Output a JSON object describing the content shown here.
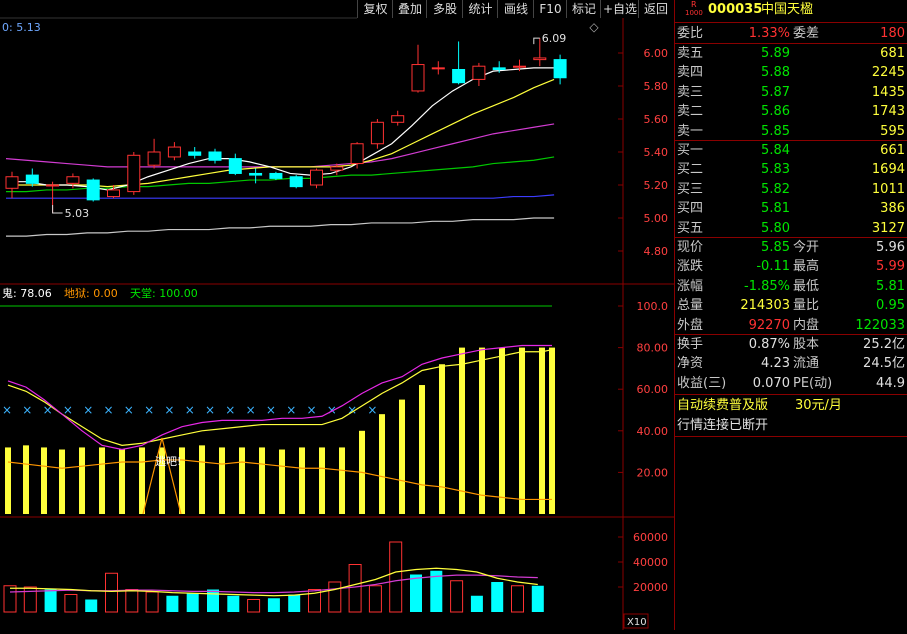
{
  "toolbar": {
    "items": [
      "复权",
      "叠加",
      "多股",
      "统计",
      "画线",
      "F10",
      "标记",
      "+自选",
      "返回"
    ],
    "diamond": "◇"
  },
  "main_chart": {
    "title_value": "0: 5.13",
    "y_ticks": [
      "6.00",
      "5.80",
      "5.60",
      "5.40",
      "5.20",
      "5.00",
      "4.80"
    ],
    "y_tick_values": [
      6.0,
      5.8,
      5.6,
      5.4,
      5.2,
      5.0,
      4.8
    ],
    "high_label": "6.09",
    "low_label": "5.03",
    "candles": [
      {
        "o": 5.18,
        "c": 5.25,
        "h": 5.28,
        "l": 5.12
      },
      {
        "o": 5.26,
        "c": 5.21,
        "h": 5.3,
        "l": 5.19
      },
      {
        "o": 5.2,
        "c": 5.2,
        "h": 5.22,
        "l": 5.03
      },
      {
        "o": 5.21,
        "c": 5.25,
        "h": 5.27,
        "l": 5.18
      },
      {
        "o": 5.23,
        "c": 5.11,
        "h": 5.24,
        "l": 5.1
      },
      {
        "o": 5.13,
        "c": 5.17,
        "h": 5.2,
        "l": 5.12
      },
      {
        "o": 5.16,
        "c": 5.38,
        "h": 5.4,
        "l": 5.14
      },
      {
        "o": 5.32,
        "c": 5.4,
        "h": 5.48,
        "l": 5.3
      },
      {
        "o": 5.37,
        "c": 5.43,
        "h": 5.46,
        "l": 5.35
      },
      {
        "o": 5.4,
        "c": 5.38,
        "h": 5.43,
        "l": 5.36
      },
      {
        "o": 5.4,
        "c": 5.35,
        "h": 5.42,
        "l": 5.33
      },
      {
        "o": 5.36,
        "c": 5.27,
        "h": 5.39,
        "l": 5.26
      },
      {
        "o": 5.27,
        "c": 5.26,
        "h": 5.3,
        "l": 5.21
      },
      {
        "o": 5.27,
        "c": 5.24,
        "h": 5.28,
        "l": 5.23
      },
      {
        "o": 5.25,
        "c": 5.19,
        "h": 5.26,
        "l": 5.18
      },
      {
        "o": 5.2,
        "c": 5.29,
        "h": 5.3,
        "l": 5.18
      },
      {
        "o": 5.29,
        "c": 5.31,
        "h": 5.33,
        "l": 5.26
      },
      {
        "o": 5.33,
        "c": 5.45,
        "h": 5.46,
        "l": 5.3
      },
      {
        "o": 5.45,
        "c": 5.58,
        "h": 5.6,
        "l": 5.42
      },
      {
        "o": 5.58,
        "c": 5.62,
        "h": 5.65,
        "l": 5.56
      },
      {
        "o": 5.77,
        "c": 5.93,
        "h": 6.05,
        "l": 5.76
      },
      {
        "o": 5.91,
        "c": 5.91,
        "h": 5.95,
        "l": 5.87
      },
      {
        "o": 5.9,
        "c": 5.82,
        "h": 6.07,
        "l": 5.81
      },
      {
        "o": 5.84,
        "c": 5.92,
        "h": 5.94,
        "l": 5.8
      },
      {
        "o": 5.91,
        "c": 5.9,
        "h": 5.95,
        "l": 5.88
      },
      {
        "o": 5.92,
        "c": 5.92,
        "h": 5.96,
        "l": 5.89
      },
      {
        "o": 5.96,
        "c": 5.97,
        "h": 6.09,
        "l": 5.92
      },
      {
        "o": 5.96,
        "c": 5.85,
        "h": 5.99,
        "l": 5.81
      }
    ],
    "ma_white": [
      5.22,
      5.22,
      5.2,
      5.2,
      5.19,
      5.17,
      5.2,
      5.25,
      5.29,
      5.33,
      5.36,
      5.36,
      5.34,
      5.31,
      5.27,
      5.26,
      5.27,
      5.31,
      5.38,
      5.45,
      5.56,
      5.68,
      5.77,
      5.84,
      5.89,
      5.9,
      5.91,
      5.91
    ],
    "ma_yellow": [
      5.2,
      5.2,
      5.2,
      5.2,
      5.2,
      5.19,
      5.2,
      5.21,
      5.23,
      5.25,
      5.27,
      5.29,
      5.3,
      5.31,
      5.31,
      5.31,
      5.31,
      5.32,
      5.35,
      5.39,
      5.45,
      5.51,
      5.57,
      5.63,
      5.68,
      5.73,
      5.79,
      5.84
    ],
    "ma_magenta": [
      5.36,
      5.35,
      5.34,
      5.33,
      5.32,
      5.31,
      5.31,
      5.31,
      5.31,
      5.31,
      5.31,
      5.31,
      5.31,
      5.31,
      5.31,
      5.31,
      5.32,
      5.33,
      5.34,
      5.36,
      5.39,
      5.42,
      5.45,
      5.48,
      5.51,
      5.53,
      5.55,
      5.57
    ],
    "ma_green": [
      5.16,
      5.16,
      5.17,
      5.17,
      5.18,
      5.18,
      5.19,
      5.19,
      5.2,
      5.21,
      5.21,
      5.22,
      5.23,
      5.23,
      5.24,
      5.24,
      5.25,
      5.26,
      5.26,
      5.27,
      5.28,
      5.29,
      5.3,
      5.31,
      5.33,
      5.34,
      5.35,
      5.37
    ],
    "ma_blue": [
      5.12,
      5.12,
      5.12,
      5.12,
      5.12,
      5.12,
      5.12,
      5.12,
      5.12,
      5.12,
      5.12,
      5.12,
      5.12,
      5.12,
      5.12,
      5.12,
      5.12,
      5.12,
      5.12,
      5.12,
      5.12,
      5.12,
      5.12,
      5.12,
      5.12,
      5.13,
      5.13,
      5.14
    ],
    "ma_grey": [
      4.89,
      4.89,
      4.9,
      4.9,
      4.91,
      4.91,
      4.92,
      4.92,
      4.93,
      4.93,
      4.93,
      4.94,
      4.94,
      4.95,
      4.95,
      4.95,
      4.96,
      4.96,
      4.97,
      4.97,
      4.97,
      4.98,
      4.98,
      4.99,
      4.99,
      4.99,
      5.0,
      5.0
    ]
  },
  "indicator": {
    "legend": [
      {
        "label": "鬼",
        "value": "78.06",
        "color": "#ffffff"
      },
      {
        "label": "地狱",
        "value": "0.00",
        "color": "#ff9600"
      },
      {
        "label": "天堂",
        "value": "100.00",
        "color": "#00e600"
      }
    ],
    "y_ticks": [
      "100.0",
      "80.00",
      "60.00",
      "40.00",
      "20.00"
    ],
    "y_tick_values": [
      100,
      80,
      60,
      40,
      20
    ],
    "bars": [
      32,
      33,
      32,
      31,
      32,
      32,
      31,
      32,
      32,
      32,
      33,
      32,
      32,
      32,
      31,
      32,
      32,
      32,
      40,
      48,
      55,
      62,
      72,
      80,
      80,
      80,
      80,
      80,
      80
    ],
    "bar_x": [
      5,
      23,
      41,
      59,
      79,
      99,
      119,
      139,
      159,
      179,
      199,
      219,
      239,
      259,
      279,
      299,
      319,
      339,
      359,
      379,
      399,
      419,
      439,
      459,
      479,
      499,
      519,
      539,
      549
    ],
    "magenta": [
      64,
      61,
      55,
      48,
      40,
      33,
      31,
      33,
      38,
      42,
      44,
      45,
      45,
      45,
      46,
      46,
      47,
      52,
      58,
      63,
      66,
      72,
      75,
      77,
      79,
      80,
      81,
      81,
      81
    ],
    "yellow": [
      62,
      59,
      54,
      48,
      42,
      36,
      33,
      34,
      36,
      38,
      40,
      41,
      42,
      43,
      43,
      43,
      43,
      46,
      52,
      58,
      63,
      69,
      71,
      72,
      74,
      76,
      78,
      78,
      79
    ],
    "orange": [
      25,
      24,
      23,
      22,
      23,
      24,
      25,
      25,
      26,
      26,
      25,
      24,
      25,
      24,
      23,
      22,
      22,
      21,
      20,
      18,
      16,
      14,
      13,
      11,
      9,
      8,
      7,
      7,
      7
    ],
    "cross_level": 50,
    "alert_label": "逃吧!"
  },
  "volume": {
    "y_ticks": [
      "60000",
      "40000",
      "20000"
    ],
    "y_tick_values": [
      60000,
      40000,
      20000
    ],
    "unit_label": "X10",
    "bars": [
      {
        "v": 21000,
        "up": true
      },
      {
        "v": 20000,
        "up": true
      },
      {
        "v": 18000,
        "up": false
      },
      {
        "v": 14000,
        "up": true
      },
      {
        "v": 10000,
        "up": false
      },
      {
        "v": 31000,
        "up": true
      },
      {
        "v": 18000,
        "up": true
      },
      {
        "v": 16000,
        "up": true
      },
      {
        "v": 13000,
        "up": false
      },
      {
        "v": 15000,
        "up": false
      },
      {
        "v": 18000,
        "up": false
      },
      {
        "v": 13000,
        "up": false
      },
      {
        "v": 10000,
        "up": true
      },
      {
        "v": 11000,
        "up": false
      },
      {
        "v": 14000,
        "up": false
      },
      {
        "v": 18000,
        "up": true
      },
      {
        "v": 24000,
        "up": true
      },
      {
        "v": 38000,
        "up": true
      },
      {
        "v": 21000,
        "up": true
      },
      {
        "v": 56000,
        "up": true
      },
      {
        "v": 30000,
        "up": false
      },
      {
        "v": 33000,
        "up": false
      },
      {
        "v": 25000,
        "up": true
      },
      {
        "v": 13000,
        "up": false
      },
      {
        "v": 24000,
        "up": false
      },
      {
        "v": 21000,
        "up": true
      },
      {
        "v": 21000,
        "up": false
      }
    ],
    "ma_yellow": [
      19000,
      19000,
      18500,
      18000,
      17000,
      16500,
      17000,
      16500,
      15500,
      15000,
      14500,
      14000,
      13500,
      13000,
      13500,
      15000,
      18000,
      22000,
      26000,
      32000,
      34000,
      35000,
      34000,
      32000,
      27000,
      24000,
      22000
    ],
    "ma_magenta": [
      16000,
      16500,
      17000,
      17500,
      17000,
      17000,
      17500,
      17500,
      17000,
      16500,
      16500,
      16000,
      15500,
      15500,
      16000,
      17000,
      18500,
      20000,
      22000,
      25000,
      27000,
      28500,
      29500,
      29500,
      29000,
      28000,
      27500
    ]
  },
  "stock": {
    "code": "000035",
    "name": "中国天楹",
    "badge_top": "R",
    "badge_bottom": "1000"
  },
  "quote": {
    "weibi_label": "委比",
    "weibi": "1.33%",
    "weicha_label": "委差",
    "weicha": "180",
    "asks": [
      {
        "label": "卖五",
        "price": "5.89",
        "vol": "681"
      },
      {
        "label": "卖四",
        "price": "5.88",
        "vol": "2245"
      },
      {
        "label": "卖三",
        "price": "5.87",
        "vol": "1435"
      },
      {
        "label": "卖二",
        "price": "5.86",
        "vol": "1743"
      },
      {
        "label": "卖一",
        "price": "5.85",
        "vol": "595"
      }
    ],
    "bids": [
      {
        "label": "买一",
        "price": "5.84",
        "vol": "661"
      },
      {
        "label": "买二",
        "price": "5.83",
        "vol": "1694"
      },
      {
        "label": "买三",
        "price": "5.82",
        "vol": "1011"
      },
      {
        "label": "买四",
        "price": "5.81",
        "vol": "386"
      },
      {
        "label": "买五",
        "price": "5.80",
        "vol": "3127"
      }
    ],
    "stats": [
      {
        "l1": "现价",
        "v1": "5.85",
        "c1": "dn",
        "l2": "今开",
        "v2": "5.96",
        "c2": "wh"
      },
      {
        "l1": "涨跌",
        "v1": "-0.11",
        "c1": "dn",
        "l2": "最高",
        "v2": "5.99",
        "c2": "up"
      },
      {
        "l1": "涨幅",
        "v1": "-1.85%",
        "c1": "dn",
        "l2": "最低",
        "v2": "5.81",
        "c2": "dn"
      },
      {
        "l1": "总量",
        "v1": "214303",
        "c1": "yl",
        "l2": "量比",
        "v2": "0.95",
        "c2": "dn"
      },
      {
        "l1": "外盘",
        "v1": "92270",
        "c1": "up",
        "l2": "内盘",
        "v2": "122033",
        "c2": "dn"
      }
    ],
    "stats2": [
      {
        "l1": "换手",
        "v1": "0.87%",
        "l2": "股本",
        "v2": "25.2亿"
      },
      {
        "l1": "净资",
        "v1": "4.23",
        "l2": "流通",
        "v2": "24.5亿"
      },
      {
        "l1": "收益(三)",
        "v1": "0.070",
        "l2": "PE(动)",
        "v2": "44.9"
      }
    ]
  },
  "notice": {
    "promo": "自动续费普及版",
    "price": "30元/月",
    "status": "行情连接已断开"
  },
  "colors": {
    "up": "#ff3232",
    "down": "#00ffff",
    "grid": "#8a0000",
    "yellow": "#ffff3c"
  }
}
